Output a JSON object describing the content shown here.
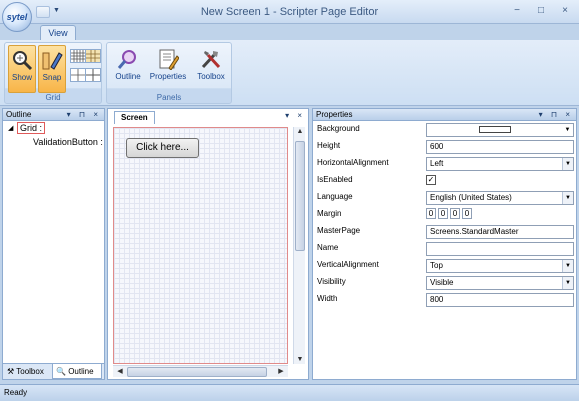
{
  "app": {
    "logo_text": "sytel",
    "title": "New Screen 1 - Scripter Page Editor",
    "window_controls": {
      "minimize": "−",
      "maximize": "□",
      "close": "×"
    }
  },
  "ribbon": {
    "tabs": [
      {
        "label": "View",
        "selected": true
      }
    ],
    "groups": [
      {
        "label": "Grid",
        "buttons": [
          {
            "label": "Show",
            "active": true,
            "icon": "magnifier-grid-icon"
          },
          {
            "label": "Snap",
            "active": true,
            "icon": "ruler-pencil-icon"
          }
        ]
      },
      {
        "label": "Panels",
        "buttons": [
          {
            "label": "Outline",
            "icon": "outline-magnifier-icon"
          },
          {
            "label": "Properties",
            "icon": "properties-document-icon"
          },
          {
            "label": "Toolbox",
            "icon": "tools-icon"
          }
        ]
      }
    ]
  },
  "outline": {
    "header": "Outline",
    "tree": {
      "root": "Grid :",
      "children": [
        "ValidationButton :"
      ]
    },
    "bottom_tabs": [
      {
        "label": "Toolbox",
        "selected": false
      },
      {
        "label": "Outline",
        "selected": true
      }
    ]
  },
  "screen": {
    "tab_label": "Screen",
    "button_text": "Click here..."
  },
  "properties": {
    "header": "Properties",
    "rows": [
      {
        "name": "Background",
        "type": "color",
        "value": "#ffffff"
      },
      {
        "name": "Height",
        "type": "text",
        "value": "600"
      },
      {
        "name": "HorizontalAlignment",
        "type": "dropdown",
        "value": "Left"
      },
      {
        "name": "IsEnabled",
        "type": "checkbox",
        "value": "✓"
      },
      {
        "name": "Language",
        "type": "dropdown",
        "value": "English (United States)"
      },
      {
        "name": "Margin",
        "type": "margin",
        "value": [
          "0",
          "0",
          "0",
          "0"
        ]
      },
      {
        "name": "MasterPage",
        "type": "text",
        "value": "Screens.StandardMaster"
      },
      {
        "name": "Name",
        "type": "text",
        "value": ""
      },
      {
        "name": "VerticalAlignment",
        "type": "dropdown",
        "value": "Top"
      },
      {
        "name": "Visibility",
        "type": "dropdown",
        "value": "Visible"
      },
      {
        "name": "Width",
        "type": "text",
        "value": "800"
      }
    ]
  },
  "status": {
    "text": "Ready"
  }
}
